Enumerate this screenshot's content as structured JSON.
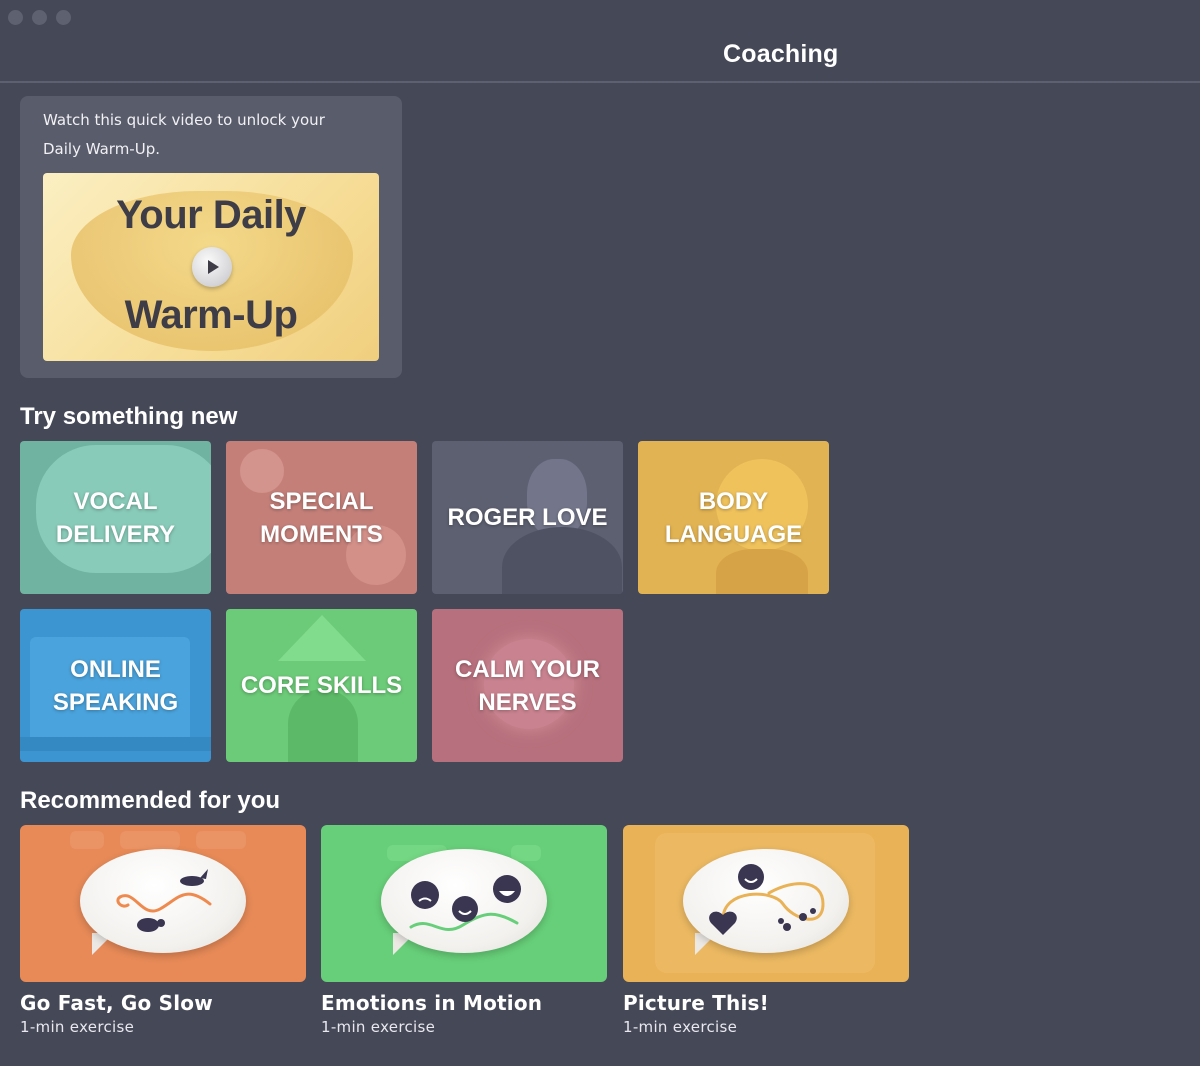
{
  "window": {
    "title": "Coaching",
    "traffic_lights": [
      "close",
      "minimize",
      "zoom"
    ]
  },
  "warmup": {
    "description": "Watch this quick video to unlock your Daily Warm-Up.",
    "video_title_line1": "Your Daily",
    "video_title_line2": "Warm-Up",
    "play_icon": "play-icon"
  },
  "try_new": {
    "heading": "Try something new",
    "tiles": [
      {
        "label": "VOCAL\nDELIVERY",
        "color": "#6fb3a0"
      },
      {
        "label": "SPECIAL\nMOMENTS",
        "color": "#c47f79"
      },
      {
        "label": "ROGER LOVE",
        "color": "#5d6071"
      },
      {
        "label": "BODY\nLANGUAGE",
        "color": "#e2b352"
      },
      {
        "label": "ONLINE\nSPEAKING",
        "color": "#3c94d0"
      },
      {
        "label": "CORE SKILLS",
        "color": "#6ccb78"
      },
      {
        "label": "CALM YOUR\nNERVES",
        "color": "#b7707d"
      }
    ]
  },
  "recommended": {
    "heading": "Recommended for you",
    "items": [
      {
        "title": "Go Fast, Go Slow",
        "subtitle": "1-min exercise",
        "color": "#e78a58"
      },
      {
        "title": "Emotions in Motion",
        "subtitle": "1-min exercise",
        "color": "#67cf79"
      },
      {
        "title": "Picture This!",
        "subtitle": "1-min exercise",
        "color": "#e9b256"
      }
    ]
  }
}
